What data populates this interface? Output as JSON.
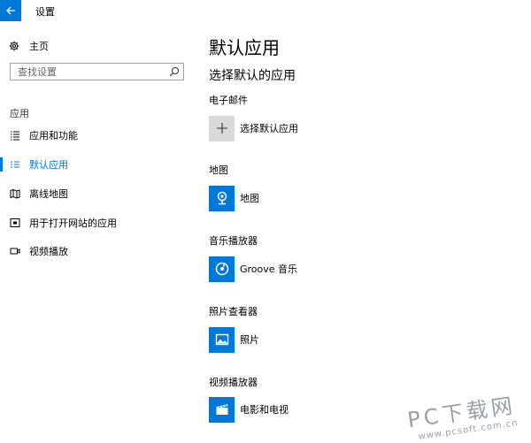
{
  "window": {
    "title": "设置"
  },
  "nav": {
    "home": "主页",
    "search_placeholder": "查找设置",
    "section": "应用",
    "items": [
      {
        "label": "应用和功能",
        "icon": "list-icon",
        "active": false
      },
      {
        "label": "默认应用",
        "icon": "defaults-list-icon",
        "active": true
      },
      {
        "label": "离线地图",
        "icon": "map-icon",
        "active": false
      },
      {
        "label": "用于打开网站的应用",
        "icon": "web-app-icon",
        "active": false
      },
      {
        "label": "视频播放",
        "icon": "video-icon",
        "active": false
      }
    ]
  },
  "main": {
    "title": "默认应用",
    "subtitle": "选择默认的应用",
    "categories": [
      {
        "heading": "电子邮件",
        "app": "选择默认应用",
        "icon": "plus-icon"
      },
      {
        "heading": "地图",
        "app": "地图",
        "icon": "maps-app-icon"
      },
      {
        "heading": "音乐播放器",
        "app": "Groove 音乐",
        "icon": "groove-music-icon"
      },
      {
        "heading": "照片查看器",
        "app": "照片",
        "icon": "photos-icon"
      },
      {
        "heading": "视频播放器",
        "app": "电影和电视",
        "icon": "movies-tv-icon"
      }
    ]
  },
  "watermark": {
    "main": "PC下载网",
    "url": "www.pcsoft.com.cn"
  },
  "colors": {
    "accent": "#0078d7",
    "tile_gray": "#d9d9d9"
  }
}
